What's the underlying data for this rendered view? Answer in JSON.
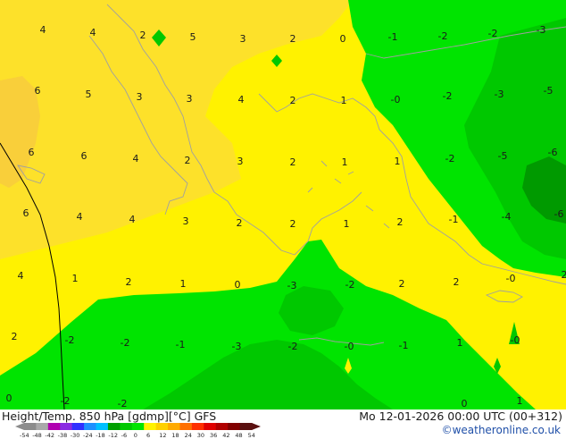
{
  "footer": {
    "title": "Height/Temp. 850 hPa [gdmp][°C] GFS",
    "date": "Mo 12-01-2026 00:00 UTC (00+312)",
    "credit": "©weatheronline.co.uk"
  },
  "colors": {
    "warm_yellow": "#fff200",
    "orange_yellow": "#fde12a",
    "light_green": "#00e400",
    "green": "#00c800",
    "dark_green": "#009a00",
    "coast_line": "#a0a0a0"
  },
  "colorbar": {
    "ticks": [
      "-54",
      "-48",
      "-42",
      "-38",
      "-30",
      "-24",
      "-18",
      "-12",
      "-6",
      "0",
      "6",
      "12",
      "18",
      "24",
      "30",
      "36",
      "42",
      "48",
      "54"
    ],
    "colors": [
      "#8c8c8c",
      "#a9a9a9",
      "#b000b0",
      "#8a2be2",
      "#3030ff",
      "#1e90ff",
      "#00c0ff",
      "#00a000",
      "#00c800",
      "#00e400",
      "#fff200",
      "#ffd000",
      "#ffaa00",
      "#ff7000",
      "#ff3000",
      "#e00000",
      "#b00000",
      "#800000",
      "#5a1010"
    ]
  },
  "temperature_labels": [
    {
      "t": "4"
    },
    {
      "t": "4"
    },
    {
      "t": "2"
    },
    {
      "t": "5"
    },
    {
      "t": "3"
    },
    {
      "t": "2"
    },
    {
      "t": "0"
    },
    {
      "t": "-1"
    },
    {
      "t": "-2"
    },
    {
      "t": "-2"
    },
    {
      "t": "-3"
    },
    {
      "t": "6"
    },
    {
      "t": "5"
    },
    {
      "t": "3"
    },
    {
      "t": "3"
    },
    {
      "t": "4"
    },
    {
      "t": "2"
    },
    {
      "t": "1"
    },
    {
      "t": "-0"
    },
    {
      "t": "-2"
    },
    {
      "t": "-3"
    },
    {
      "t": "-5"
    },
    {
      "t": "6"
    },
    {
      "t": "6"
    },
    {
      "t": "4"
    },
    {
      "t": "2"
    },
    {
      "t": "3"
    },
    {
      "t": "2"
    },
    {
      "t": "1"
    },
    {
      "t": "1"
    },
    {
      "t": "-2"
    },
    {
      "t": "-5"
    },
    {
      "t": "-6"
    },
    {
      "t": "6"
    },
    {
      "t": "4"
    },
    {
      "t": "4"
    },
    {
      "t": "3"
    },
    {
      "t": "2"
    },
    {
      "t": "2"
    },
    {
      "t": "1"
    },
    {
      "t": "2"
    },
    {
      "t": "-1"
    },
    {
      "t": "-4"
    },
    {
      "t": "-6"
    },
    {
      "t": "4"
    },
    {
      "t": "1"
    },
    {
      "t": "2"
    },
    {
      "t": "1"
    },
    {
      "t": "0"
    },
    {
      "t": "-3"
    },
    {
      "t": "-2"
    },
    {
      "t": "2"
    },
    {
      "t": "2"
    },
    {
      "t": "-0"
    },
    {
      "t": "2"
    },
    {
      "t": "2"
    },
    {
      "t": "-2"
    },
    {
      "t": "-2"
    },
    {
      "t": "-1"
    },
    {
      "t": "-3"
    },
    {
      "t": "-2"
    },
    {
      "t": "-0"
    },
    {
      "t": "-1"
    },
    {
      "t": "1"
    },
    {
      "t": "-0"
    },
    {
      "t": "0"
    },
    {
      "t": "-2"
    },
    {
      "t": "-2"
    },
    {
      "t": "0"
    },
    {
      "t": "1"
    }
  ]
}
